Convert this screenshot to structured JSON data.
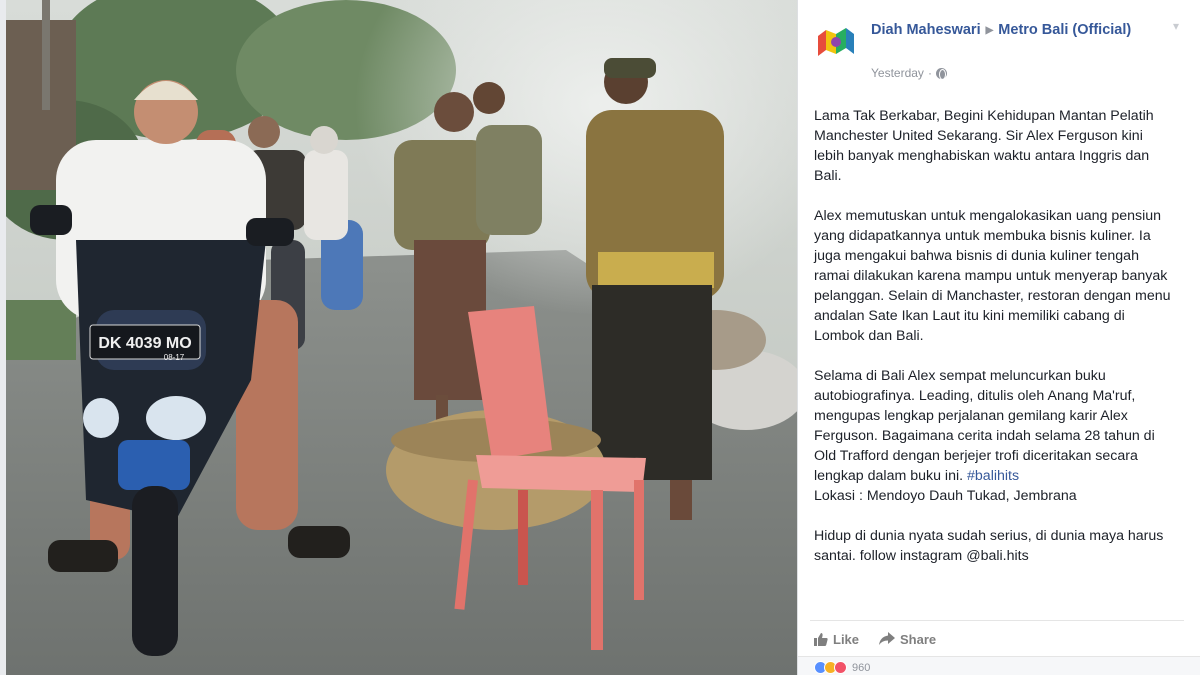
{
  "post": {
    "author": "Diah Maheswari",
    "page": "Metro Bali (Official)",
    "timestamp": "Yesterday",
    "paragraphs": [
      "Lama Tak Berkabar, Begini Kehidupan Mantan Pelatih Manchester United Sekarang. Sir Alex Ferguson kini lebih banyak menghabiskan waktu antara Inggris dan Bali.",
      "Alex memutuskan untuk mengalokasikan uang pensiun yang didapatkannya untuk membuka bisnis kuliner. Ia juga mengakui bahwa bisnis di dunia kuliner tengah ramai dilakukan karena mampu untuk menyerap banyak pelanggan. Selain di Manchaster, restoran dengan menu andalan Sate Ikan Laut itu kini memiliki cabang di Lombok dan Bali.",
      "Selama di Bali Alex sempat meluncurkan buku autobiografinya. Leading, ditulis oleh Anang Ma'ruf, mengupas lengkap perjalanan gemilang karir Alex Ferguson. Bagaimana cerita indah selama 28 tahun di Old Trafford dengan berjejer trofi diceritakan secara lengkap dalam buku ini.",
      "Hidup di dunia nyata sudah serius, di dunia maya harus santai. follow instagram @bali.hits"
    ],
    "hashtag": "#balihits",
    "location": "Lokasi : Mendoyo Dauh Tukad, Jembrana",
    "reaction_count": "960"
  },
  "actions": {
    "like": "Like",
    "share": "Share"
  },
  "photo": {
    "license_plate": "DK 4039 MO",
    "plate_sub": "08-17"
  },
  "icons": {
    "avatar": "metro-bali-logo",
    "chevron": "chevron-down-icon",
    "globe": "globe-icon",
    "like": "thumbs-up-icon",
    "share": "share-arrow-icon"
  },
  "colors": {
    "link": "#365899",
    "text": "#1d2129",
    "muted": "#90949c"
  }
}
